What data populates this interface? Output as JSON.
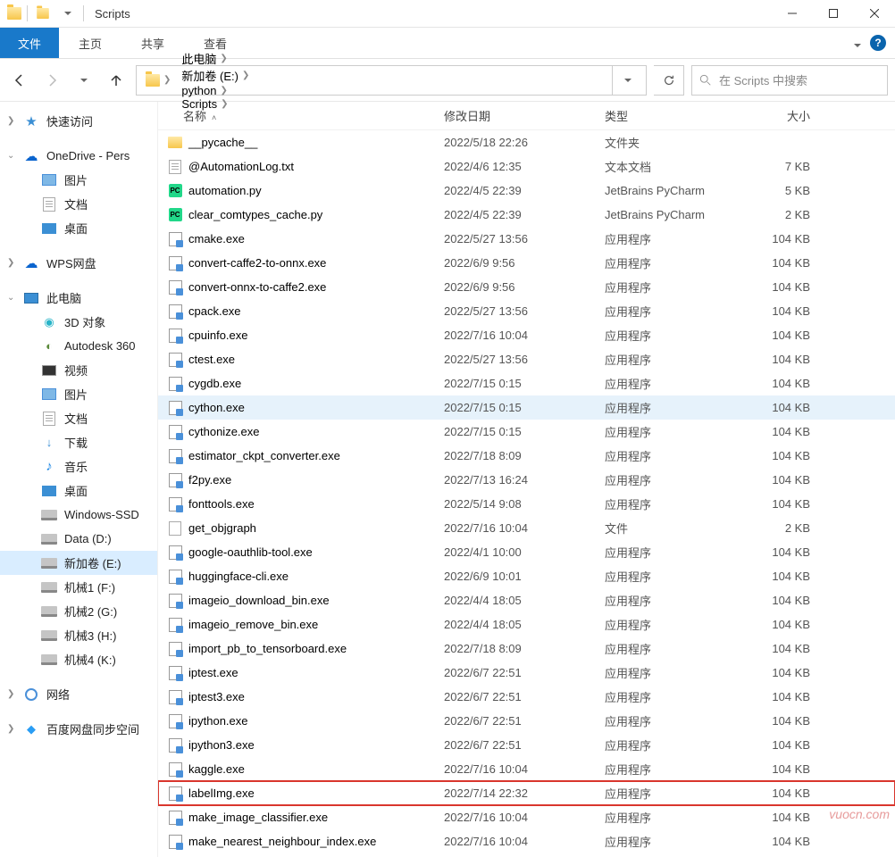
{
  "window": {
    "title": "Scripts"
  },
  "ribbon": {
    "file": "文件",
    "home": "主页",
    "share": "共享",
    "view": "查看"
  },
  "breadcrumbs": [
    "此电脑",
    "新加卷 (E:)",
    "python",
    "Scripts"
  ],
  "search": {
    "placeholder": "在 Scripts 中搜索"
  },
  "columns": {
    "name": "名称",
    "date": "修改日期",
    "type": "类型",
    "size": "大小"
  },
  "sidebar": {
    "quick": "快速访问",
    "onedrive": "OneDrive - Pers",
    "onedrive_children": [
      "图片",
      "文档",
      "桌面"
    ],
    "wps": "WPS网盘",
    "pc": "此电脑",
    "pc_children": [
      "3D 对象",
      "Autodesk 360",
      "视频",
      "图片",
      "文档",
      "下载",
      "音乐",
      "桌面",
      "Windows-SSD",
      "Data (D:)",
      "新加卷 (E:)",
      "机械1 (F:)",
      "机械2 (G:)",
      "机械3 (H:)",
      "机械4 (K:)"
    ],
    "network": "网络",
    "baidu": "百度网盘同步空间"
  },
  "files": [
    {
      "ico": "folder",
      "name": "__pycache__",
      "date": "2022/5/18 22:26",
      "type": "文件夹",
      "size": ""
    },
    {
      "ico": "txt",
      "name": "@AutomationLog.txt",
      "date": "2022/4/6 12:35",
      "type": "文本文档",
      "size": "7 KB"
    },
    {
      "ico": "py",
      "name": "automation.py",
      "date": "2022/4/5 22:39",
      "type": "JetBrains PyCharm",
      "size": "5 KB"
    },
    {
      "ico": "py",
      "name": "clear_comtypes_cache.py",
      "date": "2022/4/5 22:39",
      "type": "JetBrains PyCharm",
      "size": "2 KB"
    },
    {
      "ico": "exe",
      "name": "cmake.exe",
      "date": "2022/5/27 13:56",
      "type": "应用程序",
      "size": "104 KB"
    },
    {
      "ico": "exe",
      "name": "convert-caffe2-to-onnx.exe",
      "date": "2022/6/9 9:56",
      "type": "应用程序",
      "size": "104 KB"
    },
    {
      "ico": "exe",
      "name": "convert-onnx-to-caffe2.exe",
      "date": "2022/6/9 9:56",
      "type": "应用程序",
      "size": "104 KB"
    },
    {
      "ico": "exe",
      "name": "cpack.exe",
      "date": "2022/5/27 13:56",
      "type": "应用程序",
      "size": "104 KB"
    },
    {
      "ico": "exe",
      "name": "cpuinfo.exe",
      "date": "2022/7/16 10:04",
      "type": "应用程序",
      "size": "104 KB"
    },
    {
      "ico": "exe",
      "name": "ctest.exe",
      "date": "2022/5/27 13:56",
      "type": "应用程序",
      "size": "104 KB"
    },
    {
      "ico": "exe",
      "name": "cygdb.exe",
      "date": "2022/7/15 0:15",
      "type": "应用程序",
      "size": "104 KB"
    },
    {
      "ico": "exe",
      "name": "cython.exe",
      "date": "2022/7/15 0:15",
      "type": "应用程序",
      "size": "104 KB",
      "hover": true
    },
    {
      "ico": "exe",
      "name": "cythonize.exe",
      "date": "2022/7/15 0:15",
      "type": "应用程序",
      "size": "104 KB"
    },
    {
      "ico": "exe",
      "name": "estimator_ckpt_converter.exe",
      "date": "2022/7/18 8:09",
      "type": "应用程序",
      "size": "104 KB"
    },
    {
      "ico": "exe",
      "name": "f2py.exe",
      "date": "2022/7/13 16:24",
      "type": "应用程序",
      "size": "104 KB"
    },
    {
      "ico": "exe",
      "name": "fonttools.exe",
      "date": "2022/5/14 9:08",
      "type": "应用程序",
      "size": "104 KB"
    },
    {
      "ico": "file",
      "name": "get_objgraph",
      "date": "2022/7/16 10:04",
      "type": "文件",
      "size": "2 KB"
    },
    {
      "ico": "exe",
      "name": "google-oauthlib-tool.exe",
      "date": "2022/4/1 10:00",
      "type": "应用程序",
      "size": "104 KB"
    },
    {
      "ico": "exe",
      "name": "huggingface-cli.exe",
      "date": "2022/6/9 10:01",
      "type": "应用程序",
      "size": "104 KB"
    },
    {
      "ico": "exe",
      "name": "imageio_download_bin.exe",
      "date": "2022/4/4 18:05",
      "type": "应用程序",
      "size": "104 KB"
    },
    {
      "ico": "exe",
      "name": "imageio_remove_bin.exe",
      "date": "2022/4/4 18:05",
      "type": "应用程序",
      "size": "104 KB"
    },
    {
      "ico": "exe",
      "name": "import_pb_to_tensorboard.exe",
      "date": "2022/7/18 8:09",
      "type": "应用程序",
      "size": "104 KB"
    },
    {
      "ico": "exe",
      "name": "iptest.exe",
      "date": "2022/6/7 22:51",
      "type": "应用程序",
      "size": "104 KB"
    },
    {
      "ico": "exe",
      "name": "iptest3.exe",
      "date": "2022/6/7 22:51",
      "type": "应用程序",
      "size": "104 KB"
    },
    {
      "ico": "exe",
      "name": "ipython.exe",
      "date": "2022/6/7 22:51",
      "type": "应用程序",
      "size": "104 KB"
    },
    {
      "ico": "exe",
      "name": "ipython3.exe",
      "date": "2022/6/7 22:51",
      "type": "应用程序",
      "size": "104 KB"
    },
    {
      "ico": "exe",
      "name": "kaggle.exe",
      "date": "2022/7/16 10:04",
      "type": "应用程序",
      "size": "104 KB"
    },
    {
      "ico": "exe",
      "name": "labelImg.exe",
      "date": "2022/7/14 22:32",
      "type": "应用程序",
      "size": "104 KB",
      "hl": true
    },
    {
      "ico": "exe",
      "name": "make_image_classifier.exe",
      "date": "2022/7/16 10:04",
      "type": "应用程序",
      "size": "104 KB"
    },
    {
      "ico": "exe",
      "name": "make_nearest_neighbour_index.exe",
      "date": "2022/7/16 10:04",
      "type": "应用程序",
      "size": "104 KB"
    }
  ],
  "watermark": "vuocn.com"
}
